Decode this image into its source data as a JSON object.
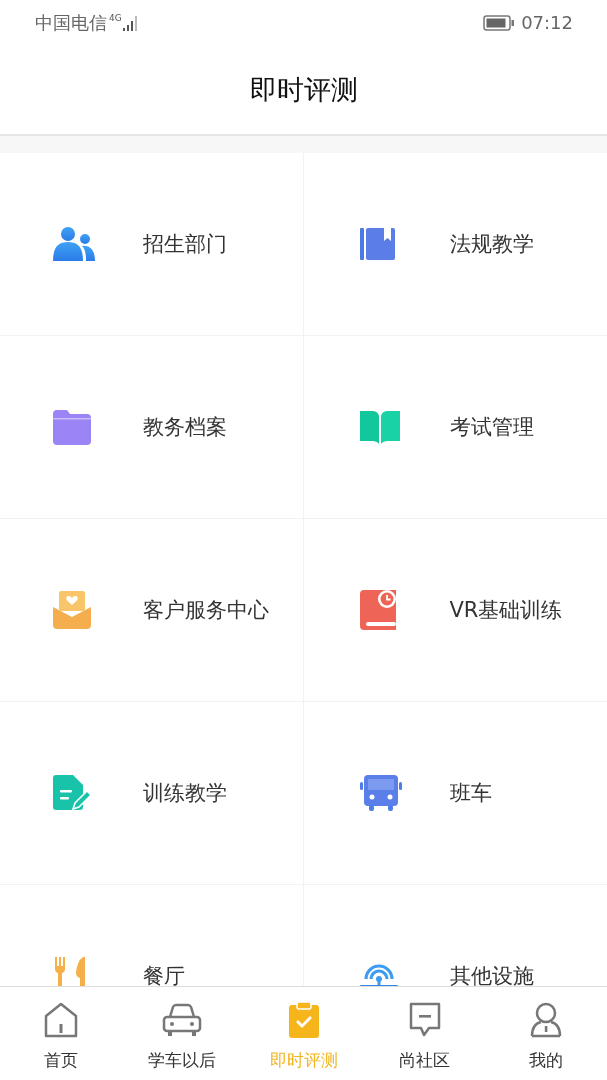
{
  "status_bar": {
    "carrier": "中国电信",
    "network": "4G",
    "time": "07:12"
  },
  "header": {
    "title": "即时评测"
  },
  "grid": {
    "items": [
      {
        "label": "招生部门"
      },
      {
        "label": "法规教学"
      },
      {
        "label": "教务档案"
      },
      {
        "label": "考试管理"
      },
      {
        "label": "客户服务中心"
      },
      {
        "label": "VR基础训练"
      },
      {
        "label": "训练教学"
      },
      {
        "label": "班车"
      },
      {
        "label": "餐厅"
      },
      {
        "label": "其他设施"
      }
    ]
  },
  "tab_bar": {
    "tabs": [
      {
        "label": "首页",
        "selected": false
      },
      {
        "label": "学车以后",
        "selected": false
      },
      {
        "label": "即时评测",
        "selected": true
      },
      {
        "label": "尚社区",
        "selected": false
      },
      {
        "label": "我的",
        "selected": false
      }
    ]
  }
}
